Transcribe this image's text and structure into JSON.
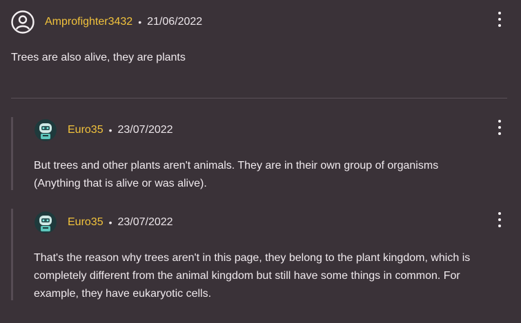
{
  "comments": [
    {
      "username": "Amprofighter3432",
      "separator": "•",
      "date": "21/06/2022",
      "text": "Trees are also alive, they are plants",
      "avatar_icon": "user-circle-icon"
    }
  ],
  "replies": [
    {
      "username": "Euro35",
      "separator": "•",
      "date": "23/07/2022",
      "text_line1": "But trees and other plants aren't animals. They are in their own group of organisms",
      "text_line2": "(Anything that is alive or was alive).",
      "avatar_icon": "robot-avatar-icon"
    },
    {
      "username": "Euro35",
      "separator": "•",
      "date": "23/07/2022",
      "text_line1": "That's the reason why trees aren't in this page, they belong to the plant kingdom, which is",
      "text_line2": "completely different from the animal kingdom but still have some things in common. For",
      "text_line3": "example, they have eukaryotic cells.",
      "avatar_icon": "robot-avatar-icon"
    }
  ],
  "colors": {
    "background": "#3a3238",
    "username": "#f2c33c",
    "text": "#ece6ea",
    "reply_bar": "#564c54"
  },
  "icons": {
    "more_options": "kebab-menu-icon"
  }
}
